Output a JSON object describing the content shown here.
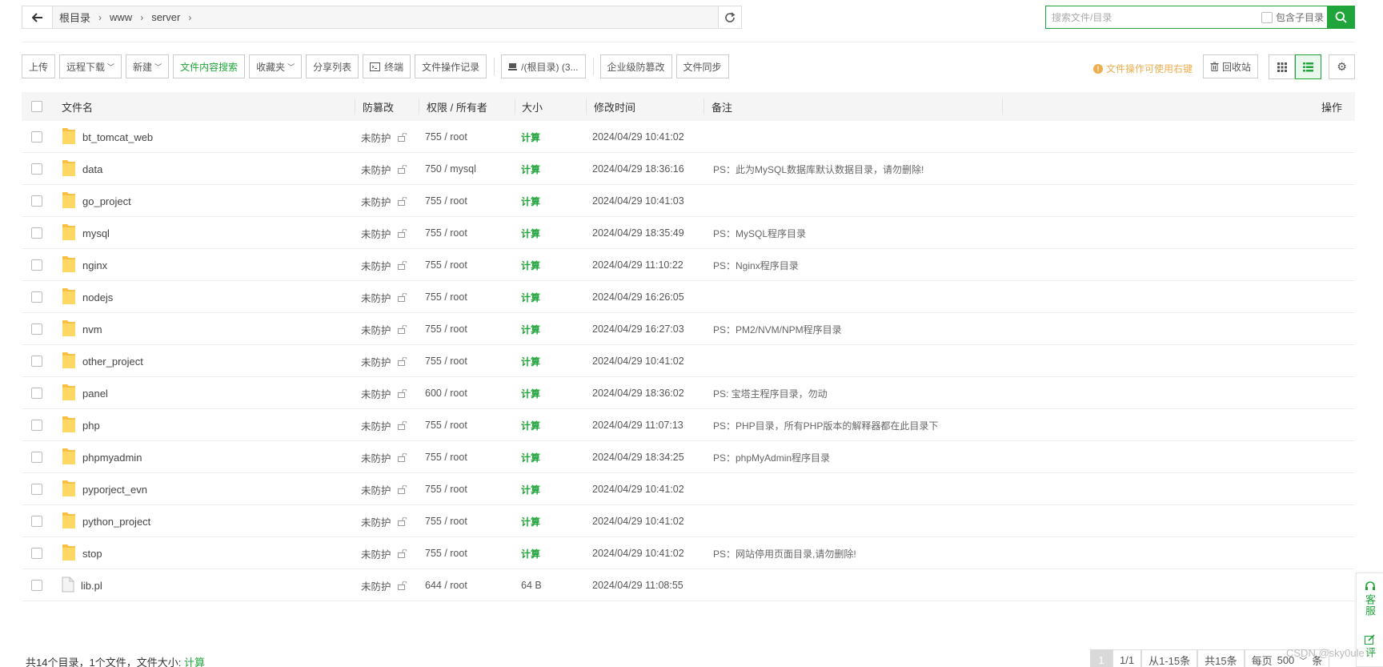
{
  "path": {
    "crumbs": [
      "根目录",
      "www",
      "server"
    ]
  },
  "search": {
    "placeholder": "搜索文件/目录",
    "subdir_label": "包含子目录"
  },
  "toolbar": {
    "upload": "上传",
    "remote_download": "远程下载",
    "new": "新建",
    "content_search": "文件内容搜索",
    "favorites": "收藏夹",
    "share_list": "分享列表",
    "terminal": "终端",
    "op_log": "文件操作记录",
    "disk": "/(根目录) (3...",
    "enterprise_protect": "企业级防篡改",
    "file_sync": "文件同步",
    "tip": "文件操作可使用右键",
    "recycle": "回收站"
  },
  "table": {
    "headers": {
      "name": "文件名",
      "protect": "防篡改",
      "perm": "权限 / 所有者",
      "size": "大小",
      "mtime": "修改时间",
      "note": "备注",
      "action": "操作"
    },
    "rows": [
      {
        "name": "bt_tomcat_web",
        "type": "folder",
        "protect": "未防护",
        "perm": "755 / root",
        "size": "计算",
        "mtime": "2024/04/29 10:41:02",
        "note": ""
      },
      {
        "name": "data",
        "type": "folder",
        "protect": "未防护",
        "perm": "750 / mysql",
        "size": "计算",
        "mtime": "2024/04/29 18:36:16",
        "note": "PS：此为MySQL数据库默认数据目录，请勿删除!"
      },
      {
        "name": "go_project",
        "type": "folder",
        "protect": "未防护",
        "perm": "755 / root",
        "size": "计算",
        "mtime": "2024/04/29 10:41:03",
        "note": ""
      },
      {
        "name": "mysql",
        "type": "folder",
        "protect": "未防护",
        "perm": "755 / root",
        "size": "计算",
        "mtime": "2024/04/29 18:35:49",
        "note": "PS：MySQL程序目录"
      },
      {
        "name": "nginx",
        "type": "folder",
        "protect": "未防护",
        "perm": "755 / root",
        "size": "计算",
        "mtime": "2024/04/29 11:10:22",
        "note": "PS：Nginx程序目录"
      },
      {
        "name": "nodejs",
        "type": "folder",
        "protect": "未防护",
        "perm": "755 / root",
        "size": "计算",
        "mtime": "2024/04/29 16:26:05",
        "note": ""
      },
      {
        "name": "nvm",
        "type": "folder",
        "protect": "未防护",
        "perm": "755 / root",
        "size": "计算",
        "mtime": "2024/04/29 16:27:03",
        "note": "PS：PM2/NVM/NPM程序目录"
      },
      {
        "name": "other_project",
        "type": "folder",
        "protect": "未防护",
        "perm": "755 / root",
        "size": "计算",
        "mtime": "2024/04/29 10:41:02",
        "note": ""
      },
      {
        "name": "panel",
        "type": "folder",
        "protect": "未防护",
        "perm": "600 / root",
        "size": "计算",
        "mtime": "2024/04/29 18:36:02",
        "note": "PS: 宝塔主程序目录，勿动"
      },
      {
        "name": "php",
        "type": "folder",
        "protect": "未防护",
        "perm": "755 / root",
        "size": "计算",
        "mtime": "2024/04/29 11:07:13",
        "note": "PS：PHP目录，所有PHP版本的解释器都在此目录下"
      },
      {
        "name": "phpmyadmin",
        "type": "folder",
        "protect": "未防护",
        "perm": "755 / root",
        "size": "计算",
        "mtime": "2024/04/29 18:34:25",
        "note": "PS：phpMyAdmin程序目录"
      },
      {
        "name": "pyporject_evn",
        "type": "folder",
        "protect": "未防护",
        "perm": "755 / root",
        "size": "计算",
        "mtime": "2024/04/29 10:41:02",
        "note": ""
      },
      {
        "name": "python_project",
        "type": "folder",
        "protect": "未防护",
        "perm": "755 / root",
        "size": "计算",
        "mtime": "2024/04/29 10:41:02",
        "note": ""
      },
      {
        "name": "stop",
        "type": "folder",
        "protect": "未防护",
        "perm": "755 / root",
        "size": "计算",
        "mtime": "2024/04/29 10:41:02",
        "note": "PS：网站停用页面目录,请勿删除!"
      },
      {
        "name": "lib.pl",
        "type": "file",
        "protect": "未防护",
        "perm": "644 / root",
        "size": "64 B",
        "mtime": "2024/04/29 11:08:55",
        "note": ""
      }
    ]
  },
  "footer": {
    "summary": "共14个目录，1个文件，文件大小:",
    "calc": "计算",
    "pager": {
      "current": "1",
      "pages": "1/1",
      "range": "从1-15条",
      "total": "共15条",
      "per_page_label": "每页",
      "per_page": "500",
      "unit": "条"
    }
  },
  "side": {
    "service": "客服",
    "feedback": "评"
  },
  "watermark": "CSDN @sky0ule",
  "colors": {
    "accent": "#20a53a",
    "tip": "#f0ad4e",
    "folder": "#f5c242"
  }
}
